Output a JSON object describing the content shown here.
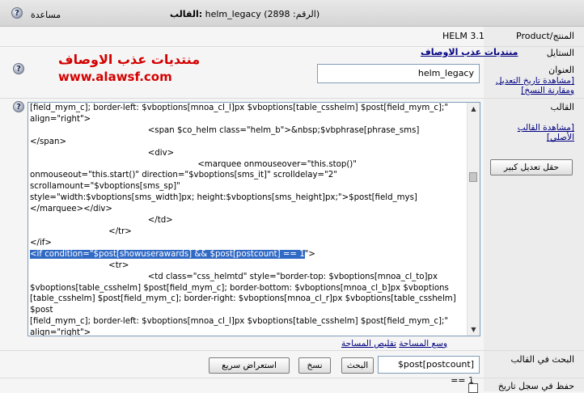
{
  "header": {
    "title_prefix": "القالب:",
    "title_name": "helm_legacy",
    "title_suffix": "(الرقم: 2898)",
    "help_label": "مساعدة"
  },
  "rows": {
    "product_label": "Product/المنتج",
    "product_value": "HELM 3.1",
    "style_label": "الستايل",
    "style_value": "منتديات عذب الاوصاف",
    "title_label": "العنوان",
    "title_value": "helm_legacy",
    "history_link": "[مشاهدة تاريخ التعديل ومقارنة النسخ]",
    "template_label": "القالب",
    "view_original_link": "[مشاهدة القالب الأصلي]",
    "large_edit_button": "حقل تعديل كبير",
    "search_label": "البحث في القالب",
    "search_value": "$post[postcount] == 1",
    "find_button": "البحث",
    "copy_button": "نسخ",
    "quick_preview_button": "استعراض سريع",
    "save_history_label": "حفظ في سجل تاريخ"
  },
  "logo": {
    "arabic_text": "منتديات عذب الاوصاف",
    "url_text": "www.alawsf.com"
  },
  "editor": {
    "lines_before": "[field_mym_c]; border-left: $vboptions[mnoa_cl_l]px $vboptions[table_csshelm] $post[field_mym_c];\"\nalign=\"right\">\n                                             <span $co_helm class=\"helm_b\">&nbsp;$vbphrase[phrase_sms]\n</span>\n                                             <div>\n                                                                <marquee onmouseover=\"this.stop()\"\nonmouseout=\"this.start()\" direction=\"$vboptions[sms_it]\" scrolldelay=\"2\" scrollamount=\"$vboptions[sms_sp]\"\nstyle=\"width:$vboptions[sms_width]px; height:$vboptions[sms_height]px;\">$post[field_mys]\n</marquee></div>\n                                             </td>\n                              </tr>\n</if>\n",
    "selected_line": "<if condition=\"$post[showuserawards] && $post[postcount] == 1",
    "selected_tail": "\">",
    "lines_after": "\n                              <tr>\n                                             <td class=\"css_helmtd\" style=\"border-top: $vboptions[mnoa_cl_to]px\n$vboptions[table_csshelm] $post[field_mym_c]; border-bottom: $vboptions[mnoa_cl_b]px $vboptions\n[table_csshelm] $post[field_mym_c]; border-right: $vboptions[mnoa_cl_r]px $vboptions[table_csshelm] $post\n[field_mym_c]; border-left: $vboptions[mnoa_cl_l]px $vboptions[table_csshelm] $post[field_mym_c];\"\nalign=\"right\">\n                                             <span $co_helm class=\"helm_b\">&nbsp;$vbphrase[award_showcase]\n</span>",
    "expand_link": "وسع المساحة",
    "shrink_link": "تقليص المساحة"
  },
  "icons": {
    "help": "question-mark-icon",
    "scroll_up": "arrow-up-icon",
    "scroll_down": "arrow-down-icon"
  },
  "colors": {
    "logo_red": "#d40000",
    "link_blue": "#000080",
    "selection": "#316ac5"
  }
}
